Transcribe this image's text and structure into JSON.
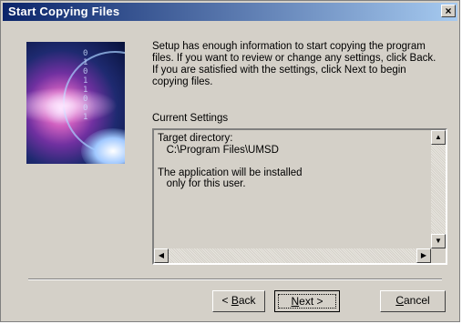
{
  "window": {
    "title": "Start Copying Files",
    "close_glyph": "×"
  },
  "intro_text": "Setup has enough information to start copying the program files. If you want to review or change any settings, click Back. If you are satisfied with the settings, click Next to begin copying files.",
  "settings": {
    "label": "Current Settings",
    "content": "Target directory:\n   C:\\Program Files\\UMSD\n\nThe application will be installed\n   only for this user."
  },
  "scrollbar_icons": {
    "up": "▲",
    "down": "▼",
    "left": "◀",
    "right": "▶"
  },
  "buttons": {
    "back": {
      "prefix": "< ",
      "mnemonic": "B",
      "rest": "ack"
    },
    "next": {
      "mnemonic": "N",
      "rest": "ext >"
    },
    "cancel": {
      "mnemonic": "C",
      "rest": "ancel"
    }
  }
}
